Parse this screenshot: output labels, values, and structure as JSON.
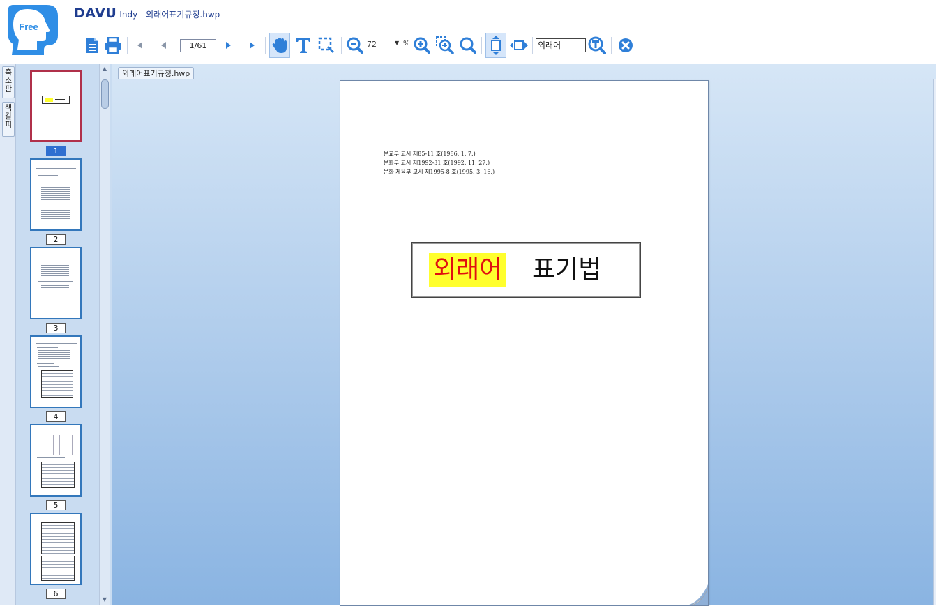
{
  "app": {
    "logo_text": "Free",
    "brand": "DAVU",
    "title_suffix": "Indy - 외래어표기규정.hwp"
  },
  "toolbar": {
    "page_indicator": "1/61",
    "zoom_value": "72",
    "zoom_unit": "%",
    "search_text": "외래어",
    "icons": [
      "document-icon",
      "print-icon",
      "first-page-icon",
      "previous-page-icon",
      "next-page-icon",
      "last-page-icon",
      "hand-tool-icon",
      "text-select-icon",
      "area-select-icon",
      "zoom-out-icon",
      "zoom-in-icon",
      "zoom-area-icon",
      "zoom-search-icon",
      "fit-height-icon",
      "fit-width-icon",
      "text-search-icon",
      "close-icon"
    ]
  },
  "left_tabs": {
    "thumbnails": "축소판",
    "bookmarks": "책갈피"
  },
  "thumbnails": {
    "pages": [
      "1",
      "2",
      "3",
      "4",
      "5",
      "6"
    ],
    "selected": "1"
  },
  "document": {
    "tab_label": "외래어표기규정.hwp",
    "notices": [
      "문교부 고시 제85-11 호(1986. 1. 7.)",
      "문화부 고시 제1992-31 호(1992. 11. 27.)",
      "문화 체육부 고시 제1995-8 호(1995. 3. 16.)"
    ],
    "title_highlight": "외래어",
    "title_rest": "표기법"
  },
  "colors": {
    "brand_blue": "#1f3d8f",
    "icon_blue": "#2f7fd8",
    "highlight_yellow": "#ffff2e",
    "title_red": "#e01010",
    "selected_thumb_border": "#b0304a"
  }
}
